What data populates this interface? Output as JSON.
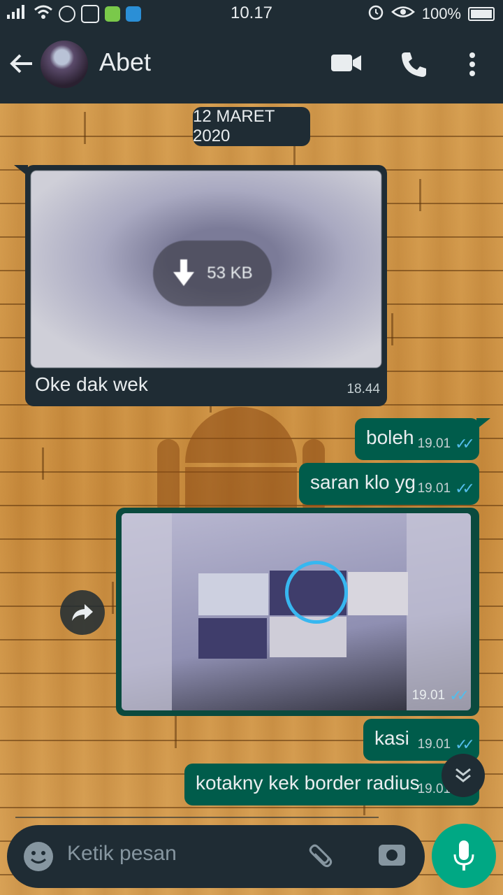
{
  "status": {
    "time": "10.17",
    "battery": "100%"
  },
  "header": {
    "contact_name": "Abet",
    "back_icon": "arrow-left-icon",
    "video_icon": "video-camera-icon",
    "call_icon": "phone-icon",
    "menu_icon": "more-vert-icon"
  },
  "chat": {
    "date_chip": "12 MARET 2020",
    "incoming_image": {
      "download_size": "53 KB",
      "caption": "Oke dak wek",
      "time": "18.44"
    },
    "outgoing": [
      {
        "text": "boleh",
        "time": "19.01"
      },
      {
        "text": "saran klo yg",
        "time": "19.01"
      }
    ],
    "outgoing_image": {
      "time": "19.01"
    },
    "outgoing_after": [
      {
        "text": "kasi",
        "time": "19.01"
      },
      {
        "text": "kotakny kek border radius",
        "time": "19.01"
      }
    ]
  },
  "input": {
    "placeholder": "Ketik pesan"
  },
  "colors": {
    "header": "#1f2c34",
    "outgoing_bubble": "#005c4b",
    "incoming_bubble": "#1f2c34",
    "mic_button": "#00a884",
    "read_ticks": "#53bdeb"
  }
}
